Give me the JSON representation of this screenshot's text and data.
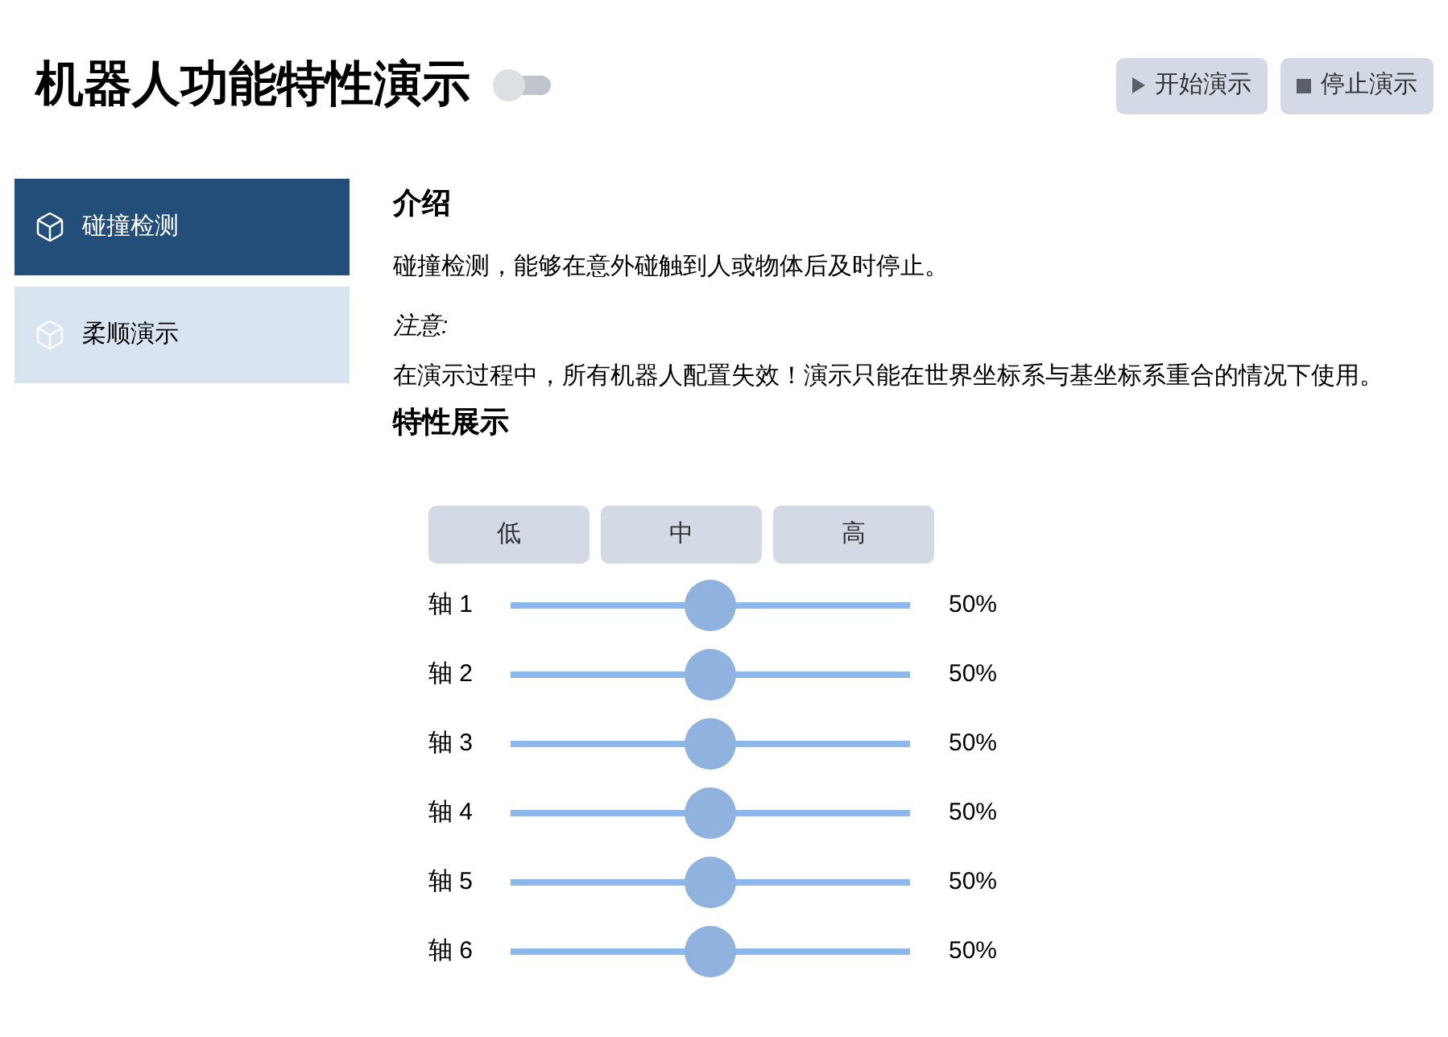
{
  "header": {
    "title": "机器人功能特性演示",
    "toggle": {
      "on": false
    },
    "buttons": [
      {
        "kind": "play",
        "label": "开始演示"
      },
      {
        "kind": "stop",
        "label": "停止演示"
      }
    ]
  },
  "sidebar": {
    "items": [
      {
        "label": "碰撞检测",
        "selected": true
      },
      {
        "label": "柔顺演示",
        "selected": false
      }
    ]
  },
  "intro": {
    "heading": "介绍",
    "description": "碰撞检测，能够在意外碰触到人或物体后及时停止。",
    "note_label": "注意:",
    "note": "在演示过程中，所有机器人配置失效！演示只能在世界坐标系与基坐标系重合的情况下使用。"
  },
  "features": {
    "heading": "特性展示",
    "presets": [
      "低",
      "中",
      "高"
    ],
    "axes": [
      {
        "label": "轴 1",
        "level": 0.5,
        "reading": "50%"
      },
      {
        "label": "轴 2",
        "level": 0.5,
        "reading": "50%"
      },
      {
        "label": "轴 3",
        "level": 0.5,
        "reading": "50%"
      },
      {
        "label": "轴 4",
        "level": 0.5,
        "reading": "50%"
      },
      {
        "label": "轴 5",
        "level": 0.5,
        "reading": "50%"
      },
      {
        "label": "轴 6",
        "level": 0.5,
        "reading": "50%"
      }
    ]
  }
}
